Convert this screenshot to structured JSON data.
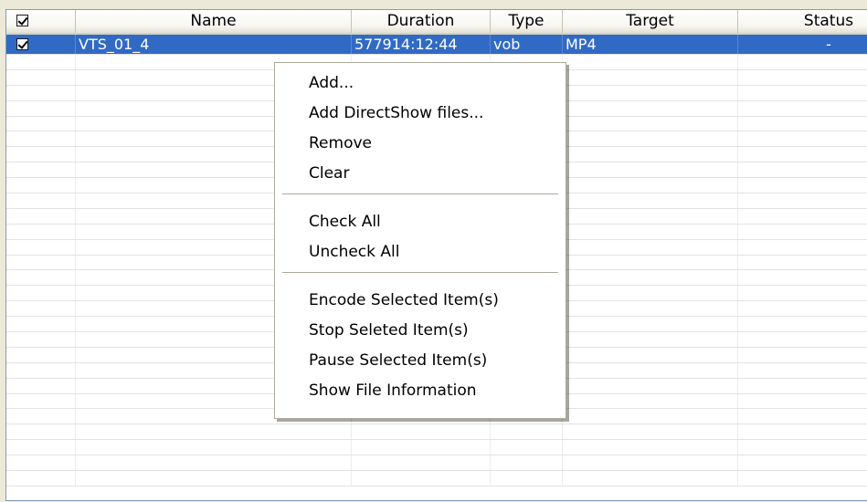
{
  "columns": {
    "name": "Name",
    "duration": "Duration",
    "type": "Type",
    "target": "Target",
    "status": "Status"
  },
  "rows": [
    {
      "checked": true,
      "name": "VTS_01_4",
      "duration": "577914:12:44",
      "type": "vob",
      "target": "MP4",
      "status": "-"
    }
  ],
  "context_menu": {
    "add": "Add...",
    "add_directshow": "Add DirectShow files...",
    "remove": "Remove",
    "clear": "Clear",
    "check_all": "Check All",
    "uncheck_all": "Uncheck All",
    "encode_selected": "Encode Selected Item(s)",
    "stop_selected": "Stop Seleted Item(s)",
    "pause_selected": "Pause Selected Item(s)",
    "show_file_info": "Show File Information"
  },
  "colors": {
    "selection": "#316ac5",
    "border": "#7f9db9",
    "menu_border": "#aca899"
  }
}
